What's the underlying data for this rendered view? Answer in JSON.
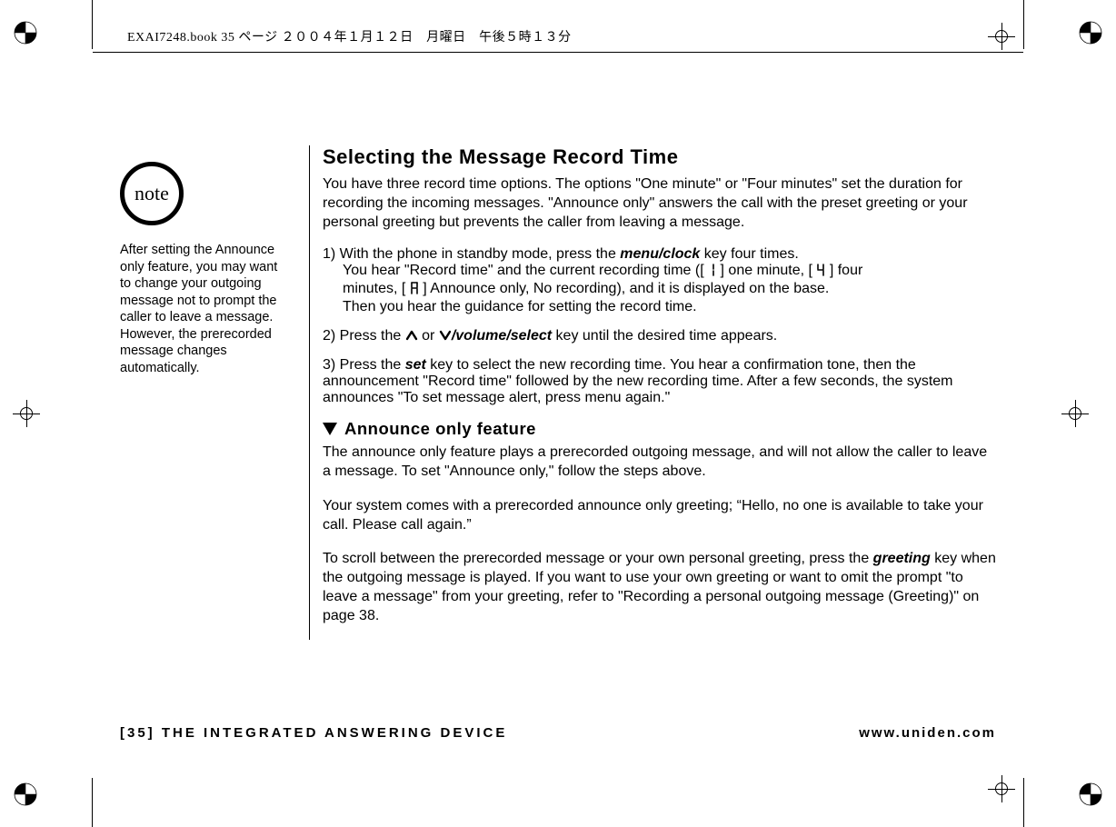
{
  "header": {
    "imprint": "EXAI7248.book  35 ページ  ２００４年１月１２日　月曜日　午後５時１３分"
  },
  "note": {
    "badge": "note",
    "body": "After setting the Announce only feature, you may want to change your outgoing message not to prompt the caller to leave a message. However, the prerecorded message changes automatically."
  },
  "main": {
    "title": "Selecting the Message Record Time",
    "intro": "You have three record time options. The options \"One minute\" or \"Four minutes\" set the duration for recording the incoming messages. \"Announce only\" answers the call with the preset greeting or your personal greeting but prevents the caller from leaving a message.",
    "step1_lead": "1) With the phone in standby mode, press the ",
    "step1_key": "menu/clock",
    "step1_tail": " key four times.",
    "step1_line2a": "You hear \"Record time\" and the current recording time ([ ",
    "step1_line2b": " ] one minute, [ ",
    "step1_line2c": " ] four",
    "step1_line3a": "minutes, [ ",
    "step1_line3b": " ] Announce only, No recording), and it is displayed on the base.",
    "step1_line4": "Then you hear the guidance for setting the record time.",
    "step2_lead": "2) Press the ",
    "step2_mid": " or ",
    "step2_key": "/volume/select",
    "step2_tail": " key until the desired time appears.",
    "step3_lead": "3) Press the ",
    "step3_key": "set",
    "step3_tail": " key to select the new recording time. You hear a confirmation tone, then the announcement \"Record time\" followed by the new recording time. After a few seconds, the system announces \"To set message alert, press menu again.\"",
    "sub_title": "Announce only feature",
    "sub_p1": "The announce only feature plays a prerecorded outgoing message, and will not allow the caller to leave a message. To set \"Announce only,\" follow the steps above.",
    "sub_p2": "Your system comes with a prerecorded announce only greeting; “Hello, no one is available to take your call. Please call again.”",
    "sub_p3a": "To scroll between the prerecorded message or your own personal greeting, press the ",
    "sub_p3_key": "greeting",
    "sub_p3b": " key when the outgoing message is played. If you want to use your own greeting or want to omit the prompt \"to leave a message\" from your greeting, refer to \"Recording a personal outgoing message (Greeting)\" on page 38."
  },
  "footer": {
    "left": "[35] THE INTEGRATED ANSWERING DEVICE",
    "right": "www.uniden.com"
  }
}
